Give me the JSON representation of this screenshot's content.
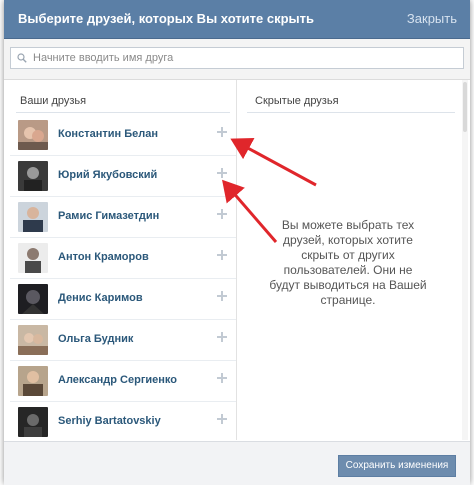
{
  "dialog": {
    "title": "Выберите друзей, которых Вы хотите скрыть",
    "close_label": "Закрыть"
  },
  "search": {
    "placeholder": "Начните вводить имя друга",
    "value": ""
  },
  "left_column": {
    "heading": "Ваши друзья",
    "friends": [
      {
        "name": "Константин Белан"
      },
      {
        "name": "Юрий Якубовский"
      },
      {
        "name": "Рамис Гимазетдин"
      },
      {
        "name": "Антон Краморов"
      },
      {
        "name": "Денис Каримов"
      },
      {
        "name": "Ольга Будник"
      },
      {
        "name": "Александр Сергиенко"
      },
      {
        "name": "Serhiy Bartatovskiy"
      }
    ]
  },
  "right_column": {
    "heading": "Скрытые друзья",
    "hint_lines": [
      "Вы можете выбрать тех",
      "друзей, которых хотите",
      "скрыть от других",
      "пользователей. Они не",
      "будут выводиться на Вашей",
      "странице."
    ]
  },
  "footer": {
    "save_label": "Сохранить изменения"
  },
  "colors": {
    "header_bg": "#5b7fa6",
    "name_link": "#2b587a",
    "save_button": "#6d8cae",
    "annotation_arrow": "#e0262b"
  },
  "icons": {
    "search": "search-icon",
    "add": "plus-icon"
  }
}
